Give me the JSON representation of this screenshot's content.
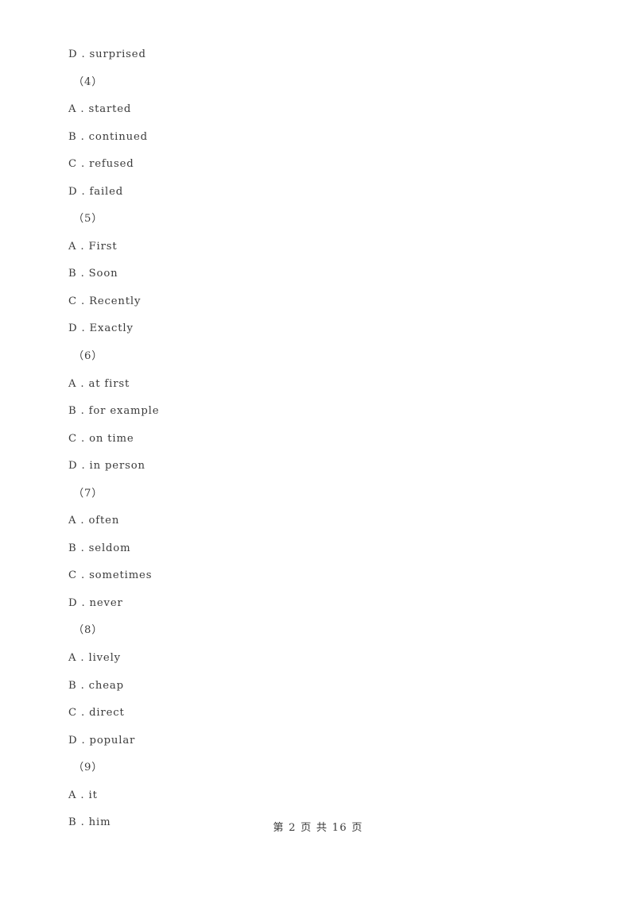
{
  "document": {
    "background_color": "#ffffff",
    "text_color": "#3b3b3b",
    "lines": [
      {
        "kind": "option",
        "text": "D . surprised"
      },
      {
        "kind": "qnum",
        "text": "（4）"
      },
      {
        "kind": "option",
        "text": "A . started"
      },
      {
        "kind": "option",
        "text": "B . continued"
      },
      {
        "kind": "option",
        "text": "C . refused"
      },
      {
        "kind": "option",
        "text": "D . failed"
      },
      {
        "kind": "qnum",
        "text": "（5）"
      },
      {
        "kind": "option",
        "text": "A . First"
      },
      {
        "kind": "option",
        "text": "B . Soon"
      },
      {
        "kind": "option",
        "text": "C . Recently"
      },
      {
        "kind": "option",
        "text": "D . Exactly"
      },
      {
        "kind": "qnum",
        "text": "（6）"
      },
      {
        "kind": "option",
        "text": "A . at first"
      },
      {
        "kind": "option",
        "text": "B . for example"
      },
      {
        "kind": "option",
        "text": "C . on time"
      },
      {
        "kind": "option",
        "text": "D . in person"
      },
      {
        "kind": "qnum",
        "text": "（7）"
      },
      {
        "kind": "option",
        "text": "A . often"
      },
      {
        "kind": "option",
        "text": "B . seldom"
      },
      {
        "kind": "option",
        "text": "C . sometimes"
      },
      {
        "kind": "option",
        "text": "D . never"
      },
      {
        "kind": "qnum",
        "text": "（8）"
      },
      {
        "kind": "option",
        "text": "A . lively"
      },
      {
        "kind": "option",
        "text": "B . cheap"
      },
      {
        "kind": "option",
        "text": "C . direct"
      },
      {
        "kind": "option",
        "text": "D . popular"
      },
      {
        "kind": "qnum",
        "text": "（9）"
      },
      {
        "kind": "option",
        "text": "A . it"
      },
      {
        "kind": "option",
        "text": "B . him"
      }
    ],
    "footer": {
      "text": "第 2 页 共 16 页",
      "current_page": "2",
      "total_pages": "16"
    }
  }
}
